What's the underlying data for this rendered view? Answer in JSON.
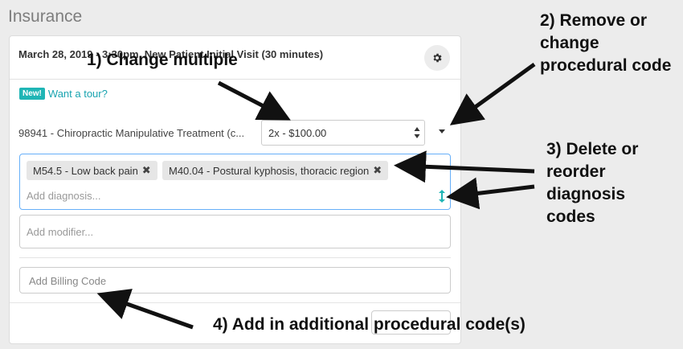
{
  "page": {
    "section_title": "Insurance"
  },
  "visit": {
    "title": "March 28, 2019 - 3:30pm, New Patient Initial Visit (30 minutes)"
  },
  "tour": {
    "badge": "New!",
    "link": "Want a tour?"
  },
  "procedure": {
    "label": "98941 - Chiropractic Manipulative Treatment (c...",
    "multiple_value": "2x - $100.00"
  },
  "diagnosis": {
    "tags": [
      {
        "label": "M54.5 - Low back pain",
        "remove": "✖"
      },
      {
        "label": "M40.04 - Postural kyphosis, thoracic region",
        "remove": "✖"
      }
    ],
    "placeholder": "Add diagnosis..."
  },
  "modifier": {
    "placeholder": "Add modifier..."
  },
  "billing": {
    "placeholder": "Add Billing Code"
  },
  "annotations": {
    "a1": "1) Change multiple",
    "a2": "2) Remove or change procedural code",
    "a3": "3) Delete or reorder diagnosis codes",
    "a4": "4) Add in additional procedural code(s)"
  },
  "icons": {
    "settings": "gear-icon",
    "updown": "updown-arrows-icon",
    "caret": "caret-down-icon",
    "reorder": "reorder-icon"
  },
  "colors": {
    "accent": "#1fb5b5",
    "link": "#19a4b0",
    "focus_border": "#66aff9"
  }
}
